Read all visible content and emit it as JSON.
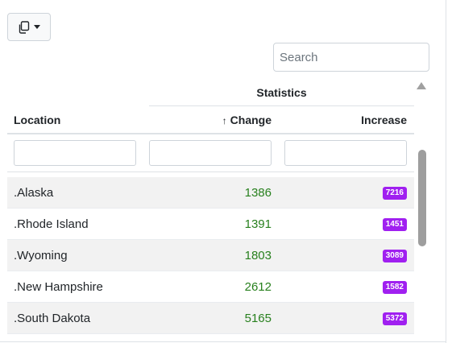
{
  "toolbar": {
    "copy_button_icon": "copy-icon",
    "dropdown_icon": "caret-down-icon"
  },
  "search": {
    "placeholder": "Search",
    "value": ""
  },
  "table": {
    "group_header": "Statistics",
    "columns": {
      "location": "Location",
      "change": "Change",
      "increase": "Increase",
      "sort_indicator": "↑"
    },
    "filters": {
      "location": "",
      "change": "",
      "increase": ""
    },
    "rows": [
      {
        "location": ".Alaska",
        "change": "1386",
        "increase": "7216"
      },
      {
        "location": ".Rhode Island",
        "change": "1391",
        "increase": "1451"
      },
      {
        "location": ".Wyoming",
        "change": "1803",
        "increase": "3089"
      },
      {
        "location": ".New Hampshire",
        "change": "2612",
        "increase": "1582"
      },
      {
        "location": ".South Dakota",
        "change": "5165",
        "increase": "5372"
      }
    ]
  },
  "colors": {
    "change_text": "#28801e",
    "increase_badge": "#a020f0",
    "stripe": "#f2f2f2"
  }
}
